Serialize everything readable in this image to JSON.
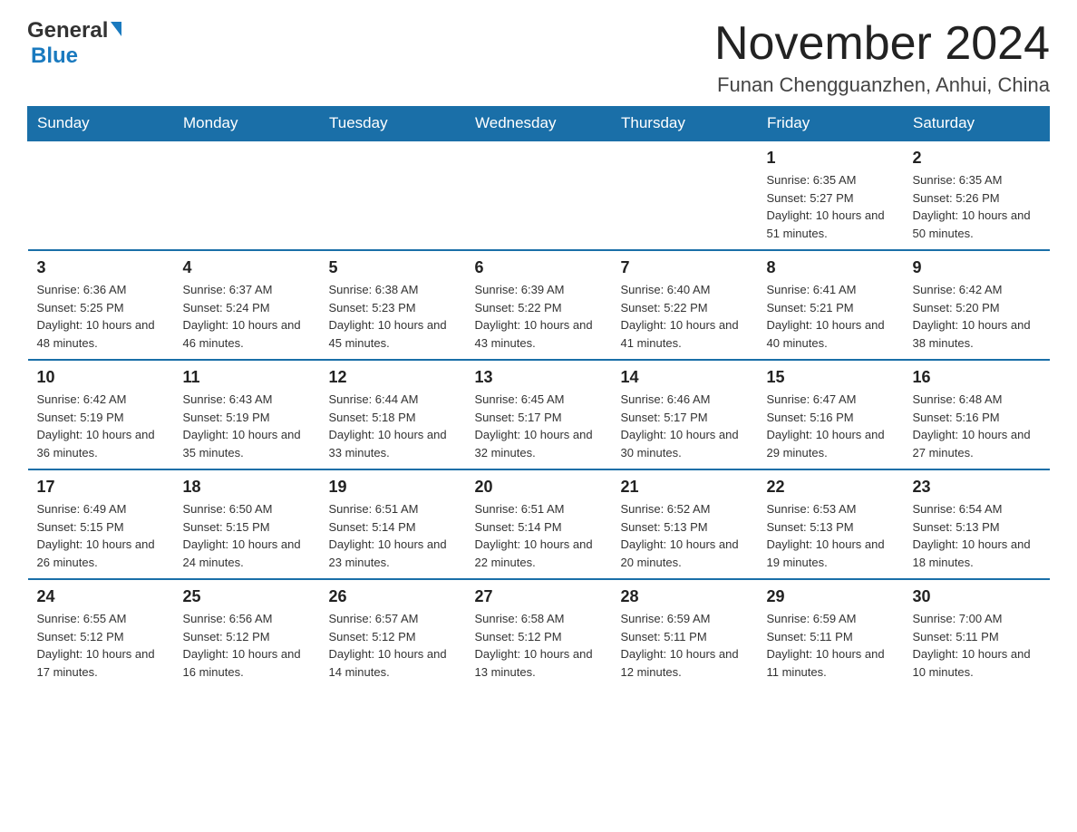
{
  "header": {
    "logo_general": "General",
    "logo_blue": "Blue",
    "month_title": "November 2024",
    "location": "Funan Chengguanzhen, Anhui, China"
  },
  "days_of_week": [
    "Sunday",
    "Monday",
    "Tuesday",
    "Wednesday",
    "Thursday",
    "Friday",
    "Saturday"
  ],
  "weeks": [
    [
      {
        "day": "",
        "info": ""
      },
      {
        "day": "",
        "info": ""
      },
      {
        "day": "",
        "info": ""
      },
      {
        "day": "",
        "info": ""
      },
      {
        "day": "",
        "info": ""
      },
      {
        "day": "1",
        "info": "Sunrise: 6:35 AM\nSunset: 5:27 PM\nDaylight: 10 hours and 51 minutes."
      },
      {
        "day": "2",
        "info": "Sunrise: 6:35 AM\nSunset: 5:26 PM\nDaylight: 10 hours and 50 minutes."
      }
    ],
    [
      {
        "day": "3",
        "info": "Sunrise: 6:36 AM\nSunset: 5:25 PM\nDaylight: 10 hours and 48 minutes."
      },
      {
        "day": "4",
        "info": "Sunrise: 6:37 AM\nSunset: 5:24 PM\nDaylight: 10 hours and 46 minutes."
      },
      {
        "day": "5",
        "info": "Sunrise: 6:38 AM\nSunset: 5:23 PM\nDaylight: 10 hours and 45 minutes."
      },
      {
        "day": "6",
        "info": "Sunrise: 6:39 AM\nSunset: 5:22 PM\nDaylight: 10 hours and 43 minutes."
      },
      {
        "day": "7",
        "info": "Sunrise: 6:40 AM\nSunset: 5:22 PM\nDaylight: 10 hours and 41 minutes."
      },
      {
        "day": "8",
        "info": "Sunrise: 6:41 AM\nSunset: 5:21 PM\nDaylight: 10 hours and 40 minutes."
      },
      {
        "day": "9",
        "info": "Sunrise: 6:42 AM\nSunset: 5:20 PM\nDaylight: 10 hours and 38 minutes."
      }
    ],
    [
      {
        "day": "10",
        "info": "Sunrise: 6:42 AM\nSunset: 5:19 PM\nDaylight: 10 hours and 36 minutes."
      },
      {
        "day": "11",
        "info": "Sunrise: 6:43 AM\nSunset: 5:19 PM\nDaylight: 10 hours and 35 minutes."
      },
      {
        "day": "12",
        "info": "Sunrise: 6:44 AM\nSunset: 5:18 PM\nDaylight: 10 hours and 33 minutes."
      },
      {
        "day": "13",
        "info": "Sunrise: 6:45 AM\nSunset: 5:17 PM\nDaylight: 10 hours and 32 minutes."
      },
      {
        "day": "14",
        "info": "Sunrise: 6:46 AM\nSunset: 5:17 PM\nDaylight: 10 hours and 30 minutes."
      },
      {
        "day": "15",
        "info": "Sunrise: 6:47 AM\nSunset: 5:16 PM\nDaylight: 10 hours and 29 minutes."
      },
      {
        "day": "16",
        "info": "Sunrise: 6:48 AM\nSunset: 5:16 PM\nDaylight: 10 hours and 27 minutes."
      }
    ],
    [
      {
        "day": "17",
        "info": "Sunrise: 6:49 AM\nSunset: 5:15 PM\nDaylight: 10 hours and 26 minutes."
      },
      {
        "day": "18",
        "info": "Sunrise: 6:50 AM\nSunset: 5:15 PM\nDaylight: 10 hours and 24 minutes."
      },
      {
        "day": "19",
        "info": "Sunrise: 6:51 AM\nSunset: 5:14 PM\nDaylight: 10 hours and 23 minutes."
      },
      {
        "day": "20",
        "info": "Sunrise: 6:51 AM\nSunset: 5:14 PM\nDaylight: 10 hours and 22 minutes."
      },
      {
        "day": "21",
        "info": "Sunrise: 6:52 AM\nSunset: 5:13 PM\nDaylight: 10 hours and 20 minutes."
      },
      {
        "day": "22",
        "info": "Sunrise: 6:53 AM\nSunset: 5:13 PM\nDaylight: 10 hours and 19 minutes."
      },
      {
        "day": "23",
        "info": "Sunrise: 6:54 AM\nSunset: 5:13 PM\nDaylight: 10 hours and 18 minutes."
      }
    ],
    [
      {
        "day": "24",
        "info": "Sunrise: 6:55 AM\nSunset: 5:12 PM\nDaylight: 10 hours and 17 minutes."
      },
      {
        "day": "25",
        "info": "Sunrise: 6:56 AM\nSunset: 5:12 PM\nDaylight: 10 hours and 16 minutes."
      },
      {
        "day": "26",
        "info": "Sunrise: 6:57 AM\nSunset: 5:12 PM\nDaylight: 10 hours and 14 minutes."
      },
      {
        "day": "27",
        "info": "Sunrise: 6:58 AM\nSunset: 5:12 PM\nDaylight: 10 hours and 13 minutes."
      },
      {
        "day": "28",
        "info": "Sunrise: 6:59 AM\nSunset: 5:11 PM\nDaylight: 10 hours and 12 minutes."
      },
      {
        "day": "29",
        "info": "Sunrise: 6:59 AM\nSunset: 5:11 PM\nDaylight: 10 hours and 11 minutes."
      },
      {
        "day": "30",
        "info": "Sunrise: 7:00 AM\nSunset: 5:11 PM\nDaylight: 10 hours and 10 minutes."
      }
    ]
  ]
}
